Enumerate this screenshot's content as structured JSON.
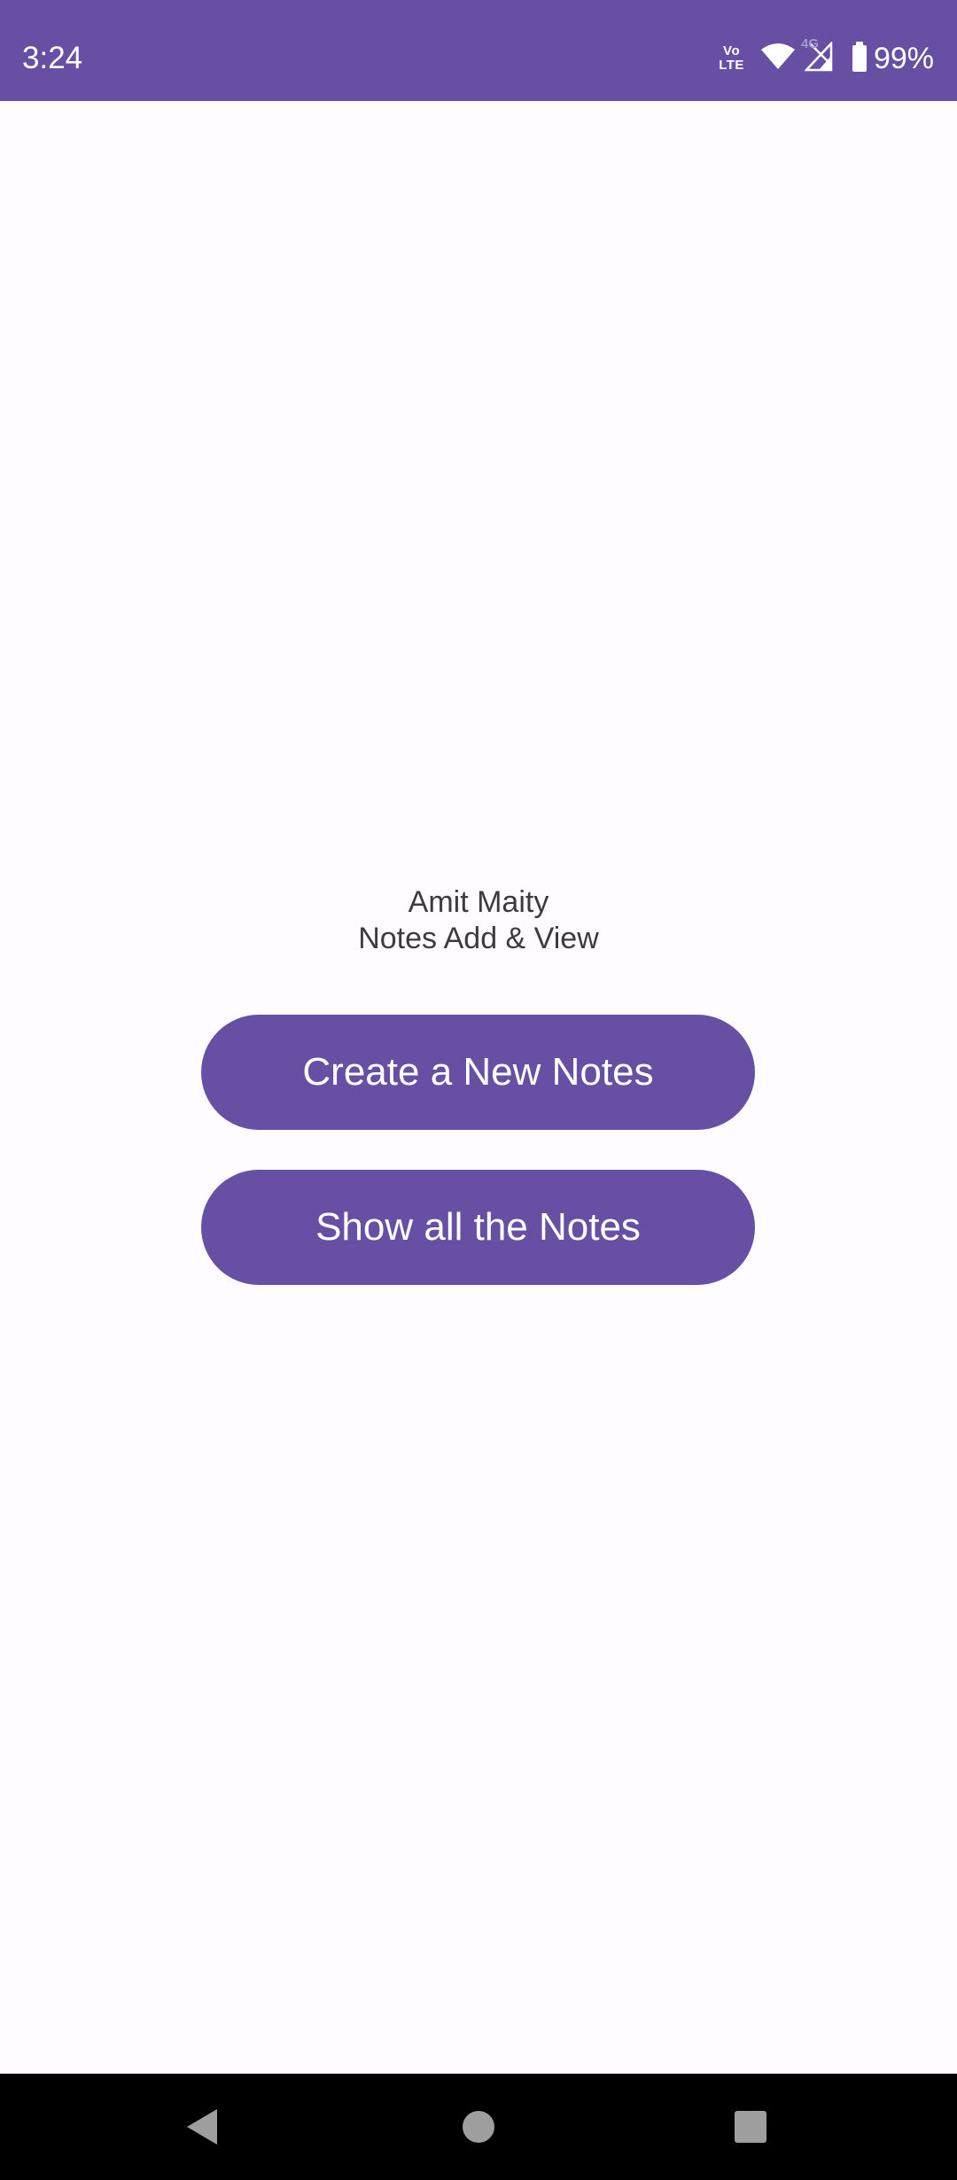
{
  "status_bar": {
    "time": "3:24",
    "volte_top": "Vo",
    "volte_bottom": "LTE",
    "network_tag": "4G",
    "battery_percent": "99%",
    "background_color": "#6750a4",
    "icons": [
      "volte-icon",
      "wifi-icon",
      "cell-signal-icon",
      "battery-icon"
    ]
  },
  "main": {
    "author": "Amit Maity",
    "subtitle": "Notes Add & View",
    "create_button_label": "Create a New Notes",
    "show_button_label": "Show all the Notes",
    "accent_color": "#6750a4",
    "background_color": "#fffbfe"
  },
  "nav_bar": {
    "icons": [
      "back-icon",
      "home-icon",
      "recents-icon"
    ],
    "background_color": "#000000"
  }
}
